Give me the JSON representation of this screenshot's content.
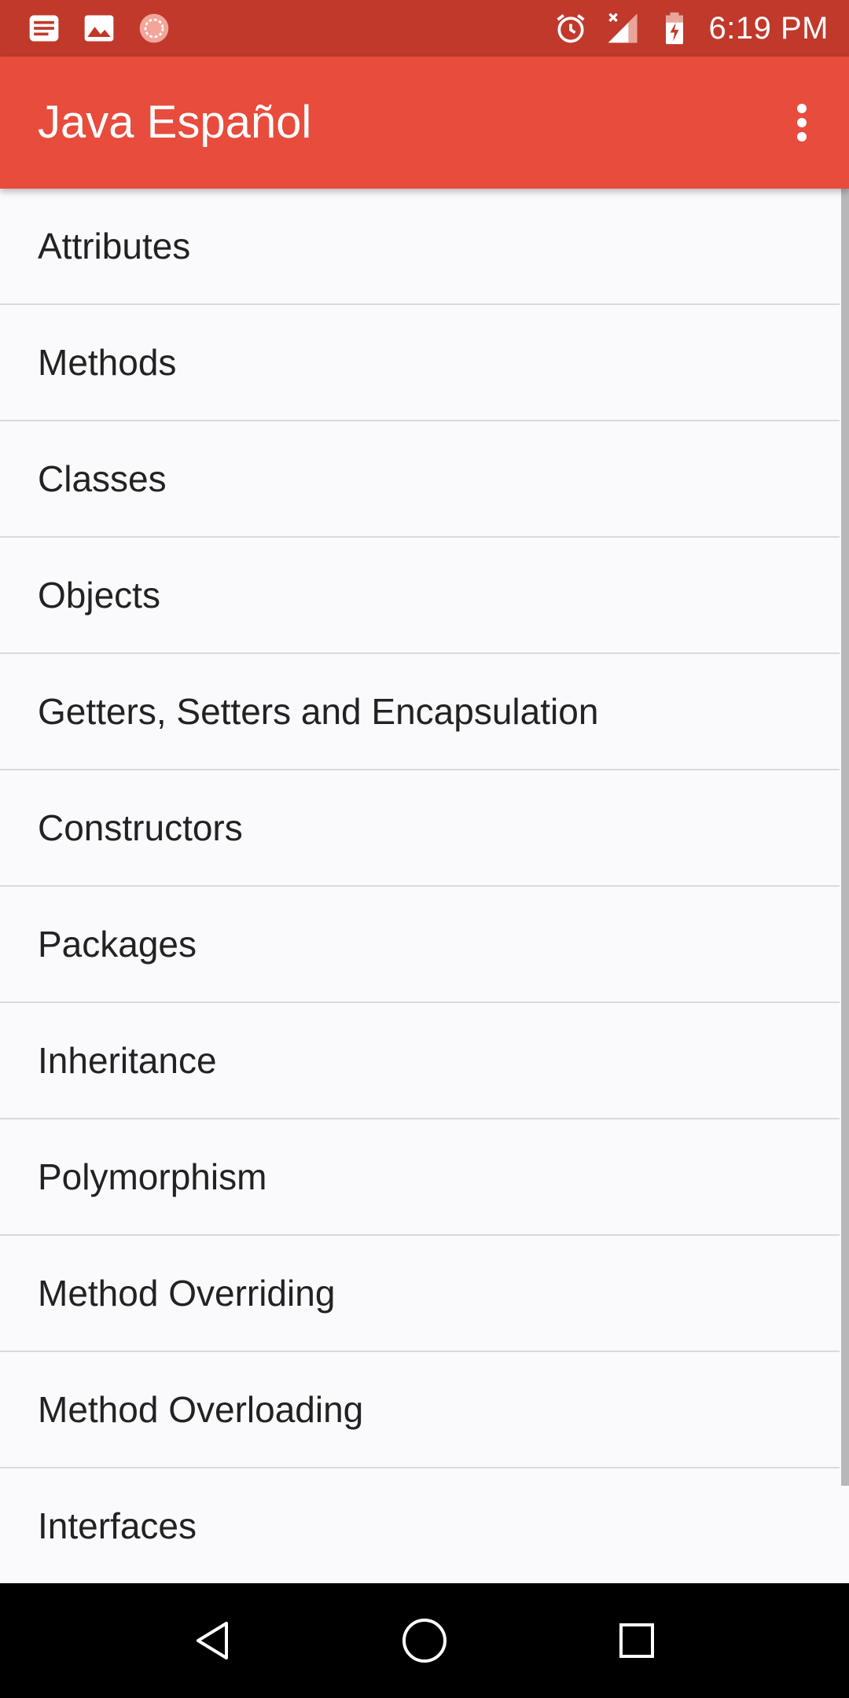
{
  "status_bar": {
    "time": "6:19 PM",
    "left_icons": [
      "news-icon",
      "image-icon",
      "sync-icon"
    ],
    "right_icons": [
      "alarm-icon",
      "signal-icon",
      "battery-charging-icon"
    ]
  },
  "app_bar": {
    "title": "Java Español",
    "overflow_icon": "more-vert-icon"
  },
  "topics": [
    "Attributes",
    "Methods",
    "Classes",
    "Objects",
    "Getters, Setters and Encapsulation",
    "Constructors",
    "Packages",
    "Inheritance",
    "Polymorphism",
    "Method Overriding",
    "Method Overloading",
    "Interfaces"
  ],
  "nav_bar": {
    "buttons": [
      "back-icon",
      "home-icon",
      "recents-icon"
    ]
  },
  "colors": {
    "status_bar": "#c0392b",
    "app_bar": "#e74c3c",
    "list_background": "#faf9fc",
    "nav_bar": "#000000"
  }
}
